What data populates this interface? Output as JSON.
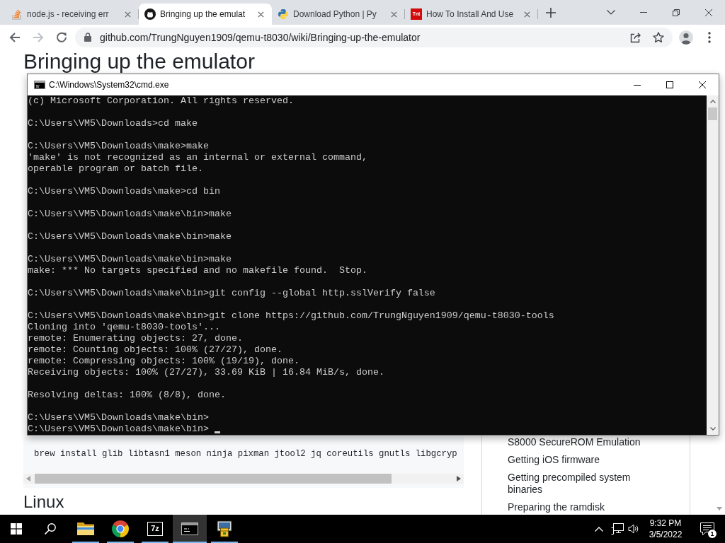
{
  "browser": {
    "tabs": [
      {
        "title": "node.js - receiving err",
        "kind": "stack",
        "selected": false
      },
      {
        "title": "Bringing up the emulat",
        "kind": "cat",
        "selected": true
      },
      {
        "title": "Download Python | Py",
        "kind": "snake",
        "selected": false
      },
      {
        "title": "How To Install And Use",
        "kind": "textlogo",
        "logo_text": "Tnt",
        "selected": false
      }
    ],
    "nav": [
      {
        "kind": "back",
        "disabled": false
      },
      {
        "kind": "forward",
        "disabled": true
      },
      {
        "kind": "reload",
        "disabled": false
      }
    ],
    "address": {
      "url": "github.com/TrungNguyen1909/qemu-t8030/wiki/Bringing-up-the-emulator"
    }
  },
  "page": {
    "title": "Bringing up the emulator",
    "code_block": {
      "code": "brew install glib libtasn1 meson ninja pixman jtool2 jq coreutils gnutls libgcryp"
    },
    "subheading": "Linux",
    "sidebar": {
      "items": [
        "S8000 SecureROM Emulation",
        "Getting iOS firmware",
        "Getting precompiled system binaries",
        "Preparing the ramdisk"
      ]
    }
  },
  "cmd": {
    "title": "C:\\Windows\\System32\\cmd.exe",
    "cursor": true,
    "lines": [
      {
        "kind": "text",
        "text": "(c) Microsoft Corporation. All rights reserved."
      },
      {
        "kind": "blank"
      },
      {
        "kind": "text",
        "text": "C:\\Users\\VM5\\Downloads>cd make"
      },
      {
        "kind": "blank"
      },
      {
        "kind": "text",
        "text": "C:\\Users\\VM5\\Downloads\\make>make"
      },
      {
        "kind": "text",
        "text": "'make' is not recognized as an internal or external command,"
      },
      {
        "kind": "text",
        "text": "operable program or batch file."
      },
      {
        "kind": "blank"
      },
      {
        "kind": "text",
        "text": "C:\\Users\\VM5\\Downloads\\make>cd bin"
      },
      {
        "kind": "blank"
      },
      {
        "kind": "text",
        "text": "C:\\Users\\VM5\\Downloads\\make\\bin>make"
      },
      {
        "kind": "blank"
      },
      {
        "kind": "text",
        "text": "C:\\Users\\VM5\\Downloads\\make\\bin>make"
      },
      {
        "kind": "blank"
      },
      {
        "kind": "text",
        "text": "C:\\Users\\VM5\\Downloads\\make\\bin>make"
      },
      {
        "kind": "text",
        "text": "make: *** No targets specified and no makefile found.  Stop."
      },
      {
        "kind": "blank"
      },
      {
        "kind": "text",
        "text": "C:\\Users\\VM5\\Downloads\\make\\bin>git config --global http.sslVerify false"
      },
      {
        "kind": "blank"
      },
      {
        "kind": "text",
        "text": "C:\\Users\\VM5\\Downloads\\make\\bin>git clone https://github.com/TrungNguyen1909/qemu-t8030-tools"
      },
      {
        "kind": "text",
        "text": "Cloning into 'qemu-t8030-tools'..."
      },
      {
        "kind": "text",
        "text": "remote: Enumerating objects: 27, done."
      },
      {
        "kind": "text",
        "text": "remote: Counting objects: 100% (27/27), done."
      },
      {
        "kind": "text",
        "text": "remote: Compressing objects: 100% (19/19), done."
      },
      {
        "kind": "text",
        "text": "Receiving objects: 100% (27/27), 33.69 KiB | 16.84 MiB/s, done."
      },
      {
        "kind": "blank"
      },
      {
        "kind": "text",
        "text": "Resolving deltas: 100% (8/8), done."
      },
      {
        "kind": "blank"
      },
      {
        "kind": "text",
        "text": "C:\\Users\\VM5\\Downloads\\make\\bin>"
      },
      {
        "kind": "text",
        "text": "C:\\Users\\VM5\\Downloads\\make\\bin>"
      }
    ]
  },
  "taskbar": {
    "buttons": [
      {
        "kind": "start"
      },
      {
        "kind": "search"
      }
    ],
    "apps": [
      {
        "kind": "folder",
        "running": true,
        "selected": false
      },
      {
        "kind": "browser",
        "running": true,
        "selected": false
      },
      {
        "kind": "archiver",
        "logo_text": "7z",
        "running": true,
        "selected": false
      },
      {
        "kind": "console",
        "running": true,
        "selected": true
      },
      {
        "kind": "installer",
        "running": true,
        "selected": false
      }
    ],
    "tray": {
      "time": "9:32 PM",
      "date": "3/5/2022",
      "notifications": "1"
    }
  }
}
